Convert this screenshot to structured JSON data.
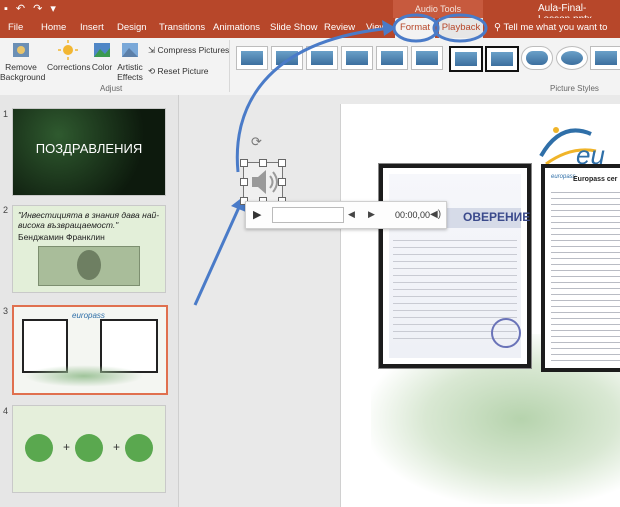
{
  "titlebar": {
    "context_group": "Audio Tools",
    "document_title": "Aula-Final-Lesson.pptx"
  },
  "tabs": {
    "file": "File",
    "home": "Home",
    "insert": "Insert",
    "design": "Design",
    "transitions": "Transitions",
    "animations": "Animations",
    "slideshow": "Slide Show",
    "review": "Review",
    "view": "View",
    "format": "Format",
    "playback": "Playback",
    "tellme": "Tell me what you want to do"
  },
  "ribbon": {
    "remove_background_1": "Remove",
    "remove_background_2": "Background",
    "corrections": "Corrections",
    "color": "Color",
    "artistic_effects_1": "Artistic",
    "artistic_effects_2": "Effects",
    "compress_pictures": "Compress Pictures",
    "reset_picture": "Reset Picture",
    "group_adjust": "Adjust",
    "group_picture_styles": "Picture Styles"
  },
  "slides": {
    "n1": "1",
    "n2": "2",
    "n3": "3",
    "n4": "4",
    "s1_title": "ПОЗДРАВЛЕНИЯ",
    "s2_quote": "\"Инвестицията в знания дава най-висока възвращаемост.\"",
    "s2_author": "Бенджамин Франклин"
  },
  "certificate": {
    "left_heading": "ОВЕРЕНИЕ",
    "europass": "europass",
    "right_heading": "Europass cer"
  },
  "player": {
    "time": "00:00,00"
  },
  "colors": {
    "accent": "#b7472a",
    "annotation": "#4a7bc8"
  }
}
